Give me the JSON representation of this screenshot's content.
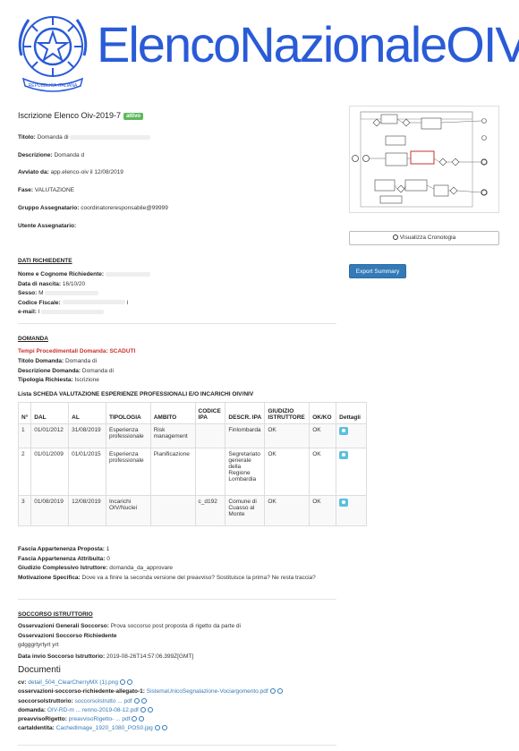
{
  "header": {
    "brand": "ElencoNazionaleOIV",
    "emblem_icon": "repubblica-italiana-emblem",
    "emblem_ribbon": "REPUBBLICA ITALIANA"
  },
  "process": {
    "title": "Iscrizione Elenco Oiv-2019-7",
    "status": "attivo",
    "fields": [
      {
        "label": "Titolo:",
        "value": "Domanda di"
      },
      {
        "label": "Descrizione:",
        "value": "Domanda d"
      },
      {
        "label": "Avviato da:",
        "value": "app.elenco-oiv il 12/08/2019"
      },
      {
        "label": "Fase:",
        "value": "VALUTAZIONE"
      },
      {
        "label": "Gruppo Assegnatario:",
        "value": "coordinatoreresponsabile@99999"
      },
      {
        "label": "Utente Assegnatario:",
        "value": ""
      }
    ]
  },
  "sidebar": {
    "cronologia_label": "Visualizza Cronologia",
    "export_label": "Export Summary"
  },
  "richiedente": {
    "title": "DATI RICHIEDENTE",
    "fields": [
      {
        "label": "Nome e Cognome Richiedente:",
        "value": ""
      },
      {
        "label": "Data di nascita:",
        "value": "16/10/20"
      },
      {
        "label": "Sesso:",
        "value": "M"
      },
      {
        "label": "Codice Fiscale:",
        "value": "I"
      },
      {
        "label": "e-mail:",
        "value": "I"
      }
    ]
  },
  "domanda": {
    "title": "DOMANDA",
    "tempi_label": "Tempi Procedimentali Domanda: SCADUTI",
    "fields": [
      {
        "label": "Titolo Domanda:",
        "value": "Domanda di"
      },
      {
        "label": "Descrizione Domanda:",
        "value": "Domanda di"
      },
      {
        "label": "Tipologia Richiesta:",
        "value": "Iscrizione"
      }
    ]
  },
  "esperienze": {
    "title": "Lista SCHEDA VALUTAZIONE ESPERIENZE PROFESSIONALI E/O INCARICHI OIV/NIV",
    "headers": [
      "N°",
      "DAL",
      "AL",
      "TIPOLOGIA",
      "AMBITO",
      "CODICE IPA",
      "DESCR. IPA",
      "GIUDIZIO ISTRUTTORE",
      "OK/KO",
      "Dettagli"
    ],
    "rows": [
      {
        "n": "1",
        "dal": "01/01/2012",
        "al": "31/08/2019",
        "tipologia": "Esperienza professionale",
        "ambito": "Risk management",
        "codice": "",
        "descr": "Finlombarda",
        "giudizio": "OK",
        "okko": "OK"
      },
      {
        "n": "2",
        "dal": "01/01/2009",
        "al": "01/01/2015",
        "tipologia": "Esperienza professionale",
        "ambito": "Pianificazione",
        "codice": "",
        "descr": "Segretariato generale della Regione Lombardia",
        "giudizio": "OK",
        "okko": "OK"
      },
      {
        "n": "3",
        "dal": "01/08/2019",
        "al": "12/08/2019",
        "tipologia": "Incarichi OIV/Nuclei",
        "ambito": "",
        "codice": "c_d192",
        "descr": "Comune di Cuasso al Monte",
        "giudizio": "OK",
        "okko": "OK"
      }
    ]
  },
  "fascia": {
    "fields": [
      {
        "label": "Fascia Appartenenza Proposta:",
        "value": "1"
      },
      {
        "label": "Fascia Appartenenza Attribuita:",
        "value": "0"
      },
      {
        "label": "Giudizio Complessivo Istruttore:",
        "value": "domanda_da_approvare"
      },
      {
        "label": "Motivazione Specifica:",
        "value": "Dove va a finire la seconda versione del preavviso? Sostituisce la prima? Ne resta traccia?"
      }
    ]
  },
  "soccorso": {
    "title": "SOCCORSO ISTRUTTORIO",
    "osservazioni_generali_label": "Osservazioni Generali Soccorso:",
    "osservazioni_generali_value": "Prova soccorso post proposta di rigetto da parte di",
    "osservazioni_richiedente_label": "Osservazioni Soccorso Richiedente",
    "osservazioni_richiedente_value": "gdgggrtyrtyrt yrt",
    "data_invio_label": "Data invio Soccorso Istruttorio:",
    "data_invio_value": "2019-08-26T14:57:06.399Z[GMT]"
  },
  "documenti": {
    "title": "Documenti",
    "items": [
      {
        "label": "cv:",
        "file": "detail_504_ClearCherryMX (1).png"
      },
      {
        "label": "osservazioni-soccorso-richiedente-allegato-1:",
        "file": "SistemaUnicoSegnalazione-Vociargomento.pdf"
      },
      {
        "label": "soccorsolstruttorio:",
        "file": "soccorsoIstrutto ... pdf"
      },
      {
        "label": "domanda:",
        "file": "OIV-RD-m ... renno-2019-08-12.pdf"
      },
      {
        "label": "preavvisoRigetto:",
        "file": "preavvisoRigetto- ... pdf"
      },
      {
        "label": "cartaIdentita:",
        "file": "CachedImage_1920_1080_POS0.jpg"
      }
    ]
  }
}
